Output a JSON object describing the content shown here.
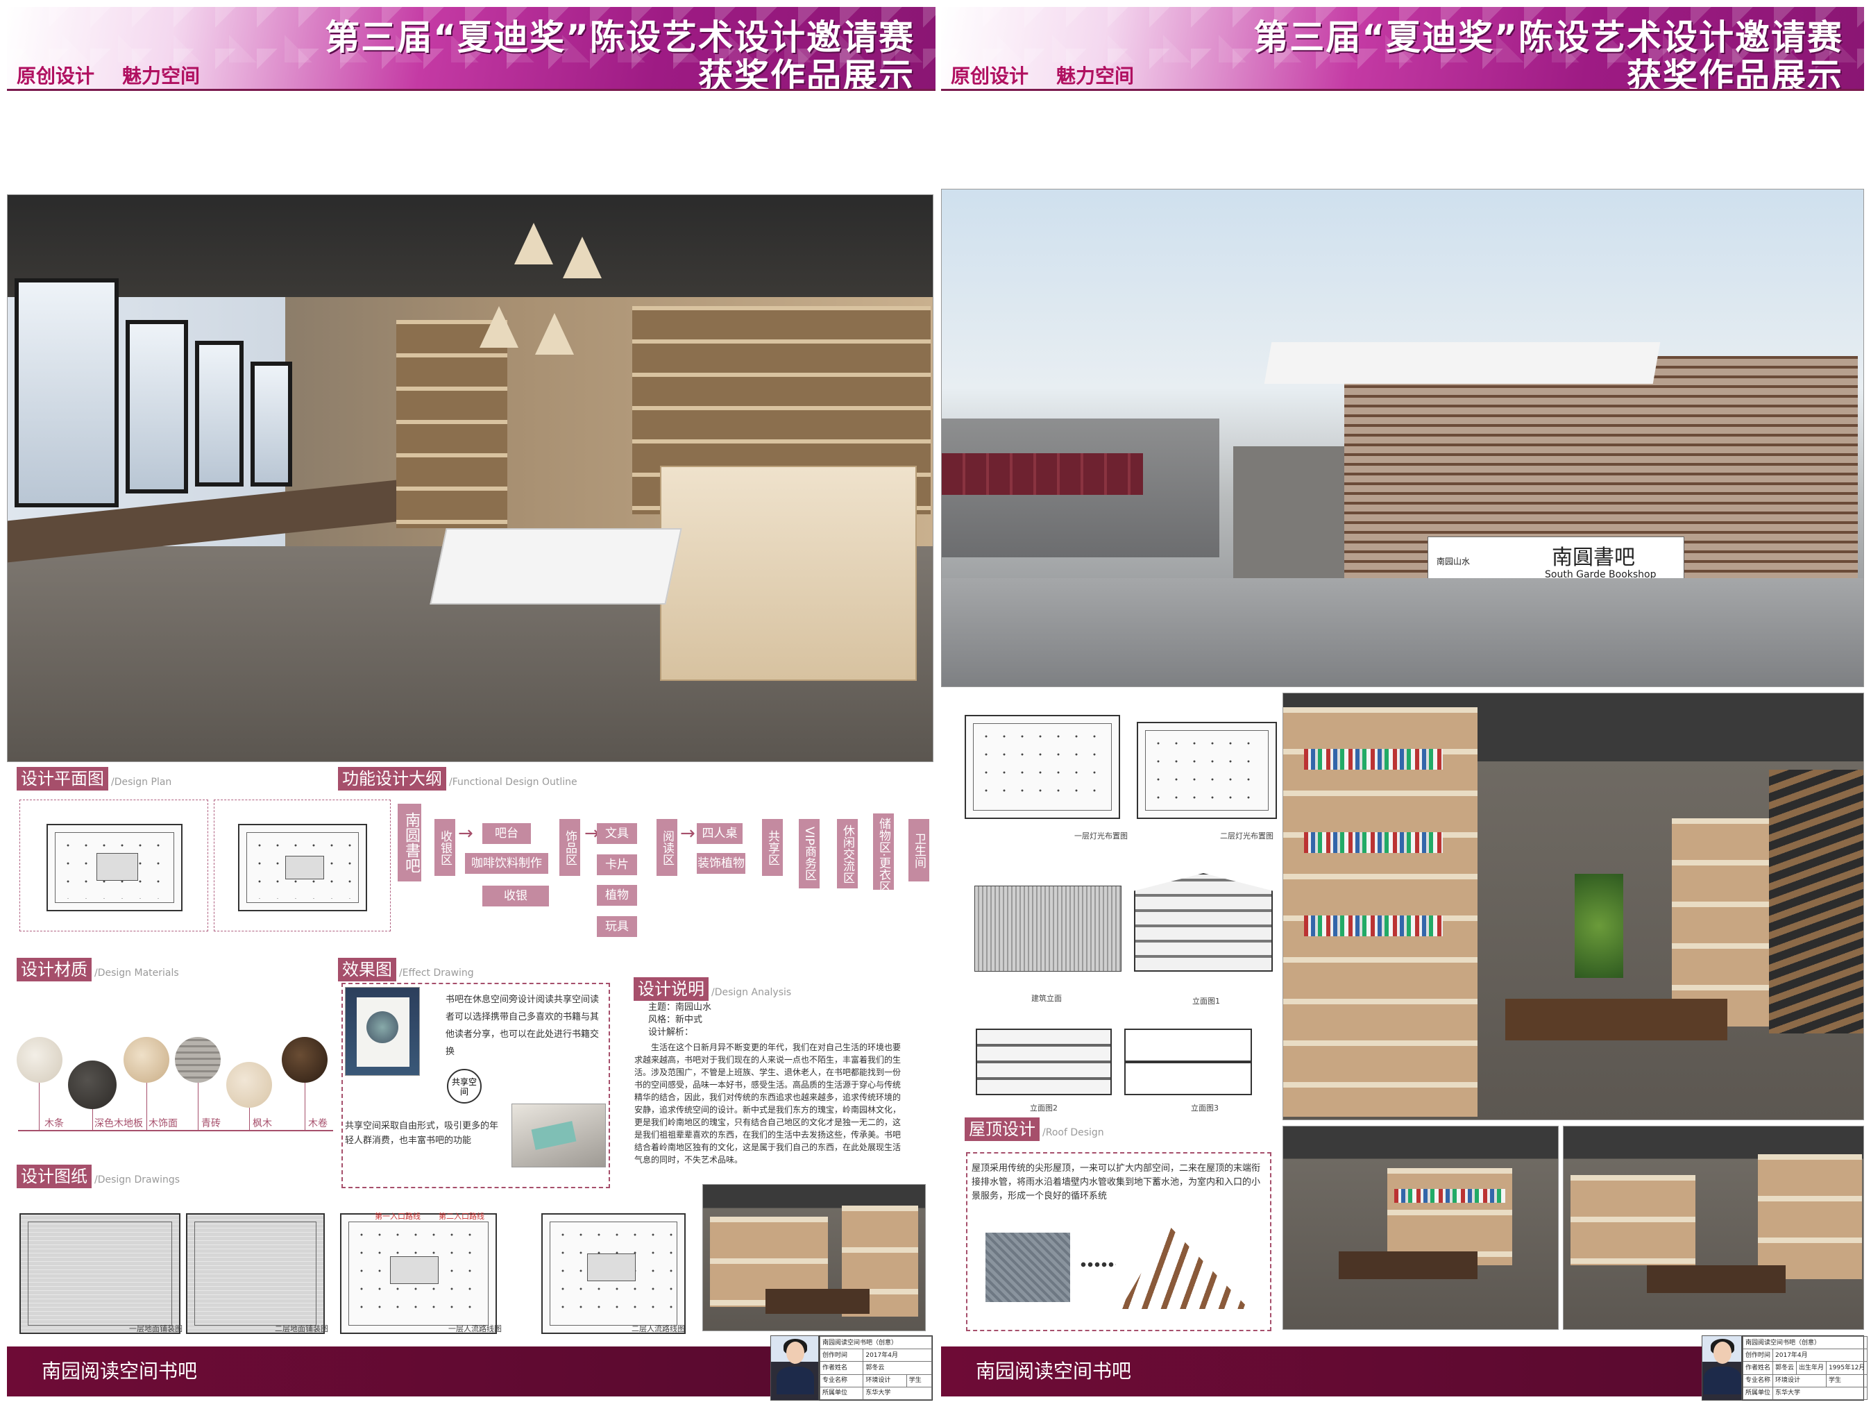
{
  "banner": {
    "title_line1": "第三届“夏迪奖”陈设艺术设计邀请赛",
    "title_line2": "获奖作品展示",
    "tag1": "原创设计",
    "tag2": "魅力空间"
  },
  "left": {
    "sections": {
      "plan": {
        "cn": "设计平面图",
        "en": "/Design  Plan"
      },
      "function": {
        "cn": "功能设计大纲",
        "en": "/Functional Design Outline"
      },
      "materials": {
        "cn": "设计材质",
        "en": "/Design Materials"
      },
      "effect": {
        "cn": "效果图",
        "en": "/Effect Drawing"
      },
      "analysis": {
        "cn": "设计说明",
        "en": "/Design  Analysis"
      },
      "drawings": {
        "cn": "设计图纸",
        "en": "/Design Drawings"
      }
    },
    "function_chart": {
      "logo_text": "南圆書吧",
      "zones": [
        "收银区",
        "饰品区",
        "阅读区",
        "共享区",
        "VIP商务区",
        "休闲交流区",
        "储物区·更衣区",
        "卫生间"
      ],
      "cashier_items": [
        "吧台",
        "咖啡饮料制作",
        "收银"
      ],
      "goods_items": [
        "文具",
        "卡片",
        "植物",
        "玩具"
      ],
      "reading_items": [
        "四人桌",
        "装饰植物"
      ]
    },
    "materials": [
      "木条",
      "深色木地板",
      "木饰面",
      "青砖",
      "枫木",
      "木卷"
    ],
    "effect": {
      "text1": "书吧在休息空间旁设计阅读共享空间读者可以选择携带自己多喜欢的书籍与其他读者分享，也可以在此处进行书籍交换",
      "bubble": "共享空间",
      "text2": "共享空间采取自由形式，吸引更多的年轻人群消费，也丰富书吧的功能"
    },
    "analysis": {
      "theme": "主题：南园山水",
      "style": "风格：新中式",
      "label": "设计解析：",
      "body": "生活在这个日新月异不断变更的年代，我们在对自己生活的环境也要求越来越高，书吧对于我们现在的人来说一点也不陌生，丰富着我们的生活。涉及范围广，不管是上班族、学生、退休老人，在书吧都能找到一份书的空间感受，品味一本好书，感受生活。高品质的生活源于穿心与传统精华的结合，因此，我们对传统的东西追求也越来越多，追求传统环境的安静，追求传统空间的设计。新中式是我们东方的瑰宝，岭南园林文化，更是我们岭南地区的瑰宝，只有结合自己地区的文化才是独一无二的，这是我们祖祖辈辈喜欢的东西，在我们的生活中去发扬这些，传承美。书吧结合着岭南地区独有的文化，这是属于我们自己的东西，在此处展现生活气息的同时，不失艺术品味。"
    },
    "drawing_captions": [
      "一层地面铺装图",
      "二层地面铺装图",
      "一层人流路线图",
      "二层人流路线图"
    ],
    "plan_top_labels": [
      "第一入口路线",
      "第二入口路线"
    ],
    "footer": "南园阅读空间书吧"
  },
  "right": {
    "sign": {
      "cn": "南圓書吧",
      "en": "South Garde Bookshop",
      "side": "南园山水"
    },
    "drawing_captions": [
      "一层灯光布置图",
      "二层灯光布置图",
      "建筑立面",
      "立面图1",
      "立面图2",
      "立面图3"
    ],
    "roof": {
      "cn": "屋顶设计",
      "en": "/Roof Design",
      "text": "屋顶采用传统的尖形屋顶，一来可以扩大内部空间，二来在屋顶的末端衔接排水管，将雨水沿着墙壁内水管收集到地下蓄水池，为室内和入口的小景服务，形成一个良好的循环系统"
    },
    "footer": "南园阅读空间书吧"
  },
  "card_left": {
    "title": "南园阅读空间书吧（创意）",
    "date_label": "创作时间",
    "date": "2017年4月",
    "name_label": "作者姓名",
    "name": "郭冬云",
    "major_label": "专业名称",
    "major": "环境设计",
    "school_label": "所属单位",
    "school": "东华大学",
    "role": "学生"
  },
  "card_right": {
    "title": "南园阅读空间书吧（创意）",
    "date_label": "创作时间",
    "date": "2017年4月",
    "name_label": "作者姓名",
    "name": "郭冬云",
    "birth_label": "出生年月",
    "birth": "1995年12月",
    "major_label": "专业名称",
    "major": "环境设计",
    "school_label": "所属单位",
    "school": "东华大学",
    "role": "学生"
  },
  "colors": {
    "accent": "#a64f6b",
    "footer": "#6e0b36",
    "banner": "#9e1b84"
  }
}
